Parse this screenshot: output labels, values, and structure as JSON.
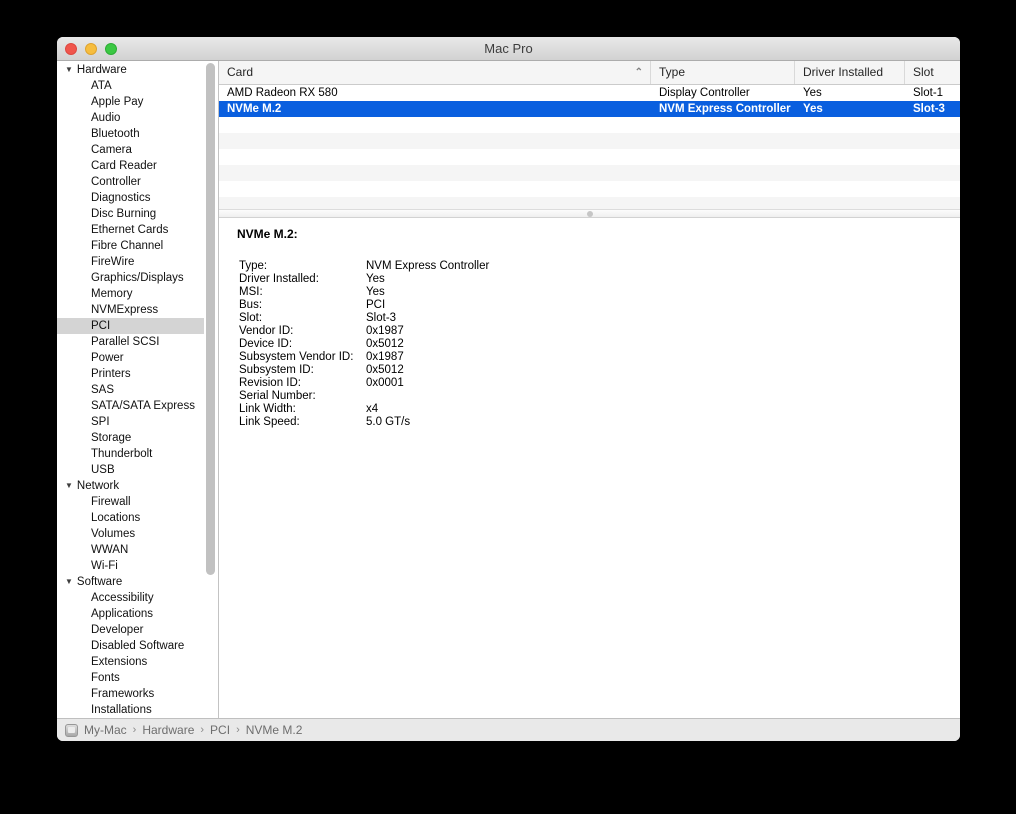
{
  "window": {
    "title": "Mac Pro"
  },
  "traffic_lights": [
    {
      "name": "close-button",
      "color": "#f0554c"
    },
    {
      "name": "minimize-button",
      "color": "#f6bd3e"
    },
    {
      "name": "zoom-button",
      "color": "#3bc843"
    }
  ],
  "sidebar": {
    "sections": [
      {
        "label": "Hardware",
        "expanded": true,
        "items": [
          {
            "label": "ATA"
          },
          {
            "label": "Apple Pay"
          },
          {
            "label": "Audio"
          },
          {
            "label": "Bluetooth"
          },
          {
            "label": "Camera"
          },
          {
            "label": "Card Reader"
          },
          {
            "label": "Controller"
          },
          {
            "label": "Diagnostics"
          },
          {
            "label": "Disc Burning"
          },
          {
            "label": "Ethernet Cards"
          },
          {
            "label": "Fibre Channel"
          },
          {
            "label": "FireWire"
          },
          {
            "label": "Graphics/Displays"
          },
          {
            "label": "Memory"
          },
          {
            "label": "NVMExpress"
          },
          {
            "label": "PCI",
            "selected": true
          },
          {
            "label": "Parallel SCSI"
          },
          {
            "label": "Power"
          },
          {
            "label": "Printers"
          },
          {
            "label": "SAS"
          },
          {
            "label": "SATA/SATA Express"
          },
          {
            "label": "SPI"
          },
          {
            "label": "Storage"
          },
          {
            "label": "Thunderbolt"
          },
          {
            "label": "USB"
          }
        ]
      },
      {
        "label": "Network",
        "expanded": true,
        "items": [
          {
            "label": "Firewall"
          },
          {
            "label": "Locations"
          },
          {
            "label": "Volumes"
          },
          {
            "label": "WWAN"
          },
          {
            "label": "Wi-Fi"
          }
        ]
      },
      {
        "label": "Software",
        "expanded": true,
        "items": [
          {
            "label": "Accessibility"
          },
          {
            "label": "Applications"
          },
          {
            "label": "Developer"
          },
          {
            "label": "Disabled Software"
          },
          {
            "label": "Extensions"
          },
          {
            "label": "Fonts"
          },
          {
            "label": "Frameworks"
          },
          {
            "label": "Installations"
          }
        ]
      }
    ]
  },
  "table": {
    "columns": [
      {
        "label": "Card",
        "sort": "asc"
      },
      {
        "label": "Type"
      },
      {
        "label": "Driver Installed"
      },
      {
        "label": "Slot"
      }
    ],
    "sort_icon": "⌃",
    "rows": [
      {
        "card": "AMD Radeon RX 580",
        "type": "Display Controller",
        "driver_installed": "Yes",
        "slot": "Slot-1",
        "selected": false
      },
      {
        "card": "NVMe M.2",
        "type": "NVM Express Controller",
        "driver_installed": "Yes",
        "slot": "Slot-3",
        "selected": true
      }
    ],
    "empty_row_count": 6
  },
  "details": {
    "title": "NVMe M.2:",
    "rows": [
      {
        "label": "Type:",
        "value": "NVM Express Controller"
      },
      {
        "label": "Driver Installed:",
        "value": "Yes"
      },
      {
        "label": "MSI:",
        "value": "Yes"
      },
      {
        "label": "Bus:",
        "value": "PCI"
      },
      {
        "label": "Slot:",
        "value": "Slot-3"
      },
      {
        "label": "Vendor ID:",
        "value": "0x1987"
      },
      {
        "label": "Device ID:",
        "value": "0x5012"
      },
      {
        "label": "Subsystem Vendor ID:",
        "value": "0x1987"
      },
      {
        "label": "Subsystem ID:",
        "value": "0x5012"
      },
      {
        "label": "Revision ID:",
        "value": "0x0001"
      },
      {
        "label": "Serial Number:",
        "value": ""
      },
      {
        "label": "Link Width:",
        "value": "x4"
      },
      {
        "label": "Link Speed:",
        "value": "5.0 GT/s"
      }
    ]
  },
  "breadcrumb": {
    "separator": "›",
    "items": [
      "My-Mac",
      "Hardware",
      "PCI",
      "NVMe M.2"
    ]
  },
  "colors": {
    "selection_blue": "#0a5fdf",
    "sidebar_selected_gray": "#d4d4d4",
    "row_stripe": "#f5f5f5",
    "titlebar_top": "#e9e9e9",
    "titlebar_bottom": "#d2d2d2",
    "statusbar_bg": "#e9e9e9",
    "desktop_bg": "#000000"
  }
}
